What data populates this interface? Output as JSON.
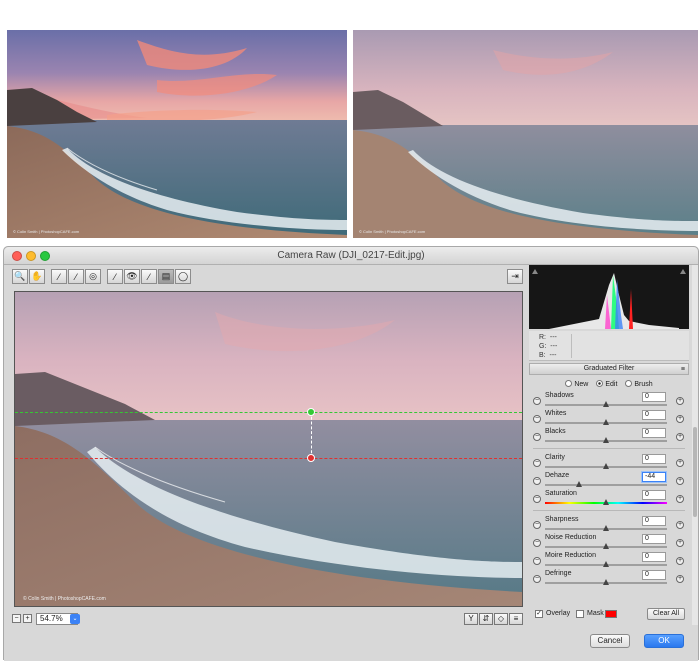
{
  "photos": {
    "before_credit": "© Colin Smith | PhotoshopCAFE.com",
    "after_credit": "© Colin Smith | PhotoshopCAFE.com"
  },
  "window": {
    "title": "Camera Raw (DJI_0217-Edit.jpg)",
    "traffic_colors": {
      "close": "#ff5f57",
      "minimize": "#febc2e",
      "zoom": "#28c840"
    }
  },
  "toolbar": {
    "tools": [
      {
        "name": "zoom-tool",
        "glyph": "🔍"
      },
      {
        "name": "hand-tool",
        "glyph": "✋"
      },
      {
        "name": "white-balance-tool",
        "glyph": "⁄"
      },
      {
        "name": "color-sampler-tool",
        "glyph": "⁄"
      },
      {
        "name": "targeted-adjustment-tool",
        "glyph": "◎"
      },
      {
        "name": "straighten-tool",
        "glyph": "⁄"
      },
      {
        "name": "red-eye-tool",
        "glyph": "👁"
      },
      {
        "name": "adjustment-brush-tool",
        "glyph": "⁄"
      },
      {
        "name": "graduated-filter-tool",
        "glyph": "▤"
      },
      {
        "name": "radial-filter-tool",
        "glyph": "◯"
      }
    ],
    "open-preferences-glyph": "⇥"
  },
  "preview": {
    "credit": "© Colin Smith | PhotoshopCAFE.com",
    "guide_colors": {
      "start": "#34c834",
      "end": "#e03030"
    }
  },
  "zoom": {
    "value": "54.7%"
  },
  "rgb_readout": {
    "r_label": "R:",
    "g_label": "G:",
    "b_label": "B:",
    "r": "---",
    "g": "---",
    "b": "---"
  },
  "panel": {
    "title": "Graduated Filter",
    "modes": {
      "new": "New",
      "edit": "Edit",
      "brush": "Brush",
      "selected": "Edit"
    },
    "sliders": [
      {
        "id": "shadows",
        "label": "Shadows",
        "value": "0"
      },
      {
        "id": "whites",
        "label": "Whites",
        "value": "0"
      },
      {
        "id": "blacks",
        "label": "Blacks",
        "value": "0"
      },
      {
        "id": "clarity",
        "label": "Clarity",
        "value": "0"
      },
      {
        "id": "dehaze",
        "label": "Dehaze",
        "value": "-44"
      },
      {
        "id": "saturation",
        "label": "Saturation",
        "value": "0"
      },
      {
        "id": "sharpness",
        "label": "Sharpness",
        "value": "0"
      },
      {
        "id": "noise-reduction",
        "label": "Noise Reduction",
        "value": "0"
      },
      {
        "id": "moire-reduction",
        "label": "Moire Reduction",
        "value": "0"
      },
      {
        "id": "defringe",
        "label": "Defringe",
        "value": "0"
      }
    ],
    "overlay_label": "Overlay",
    "overlay_checked": true,
    "mask_label": "Mask",
    "mask_checked": false,
    "mask_color": "#ff0000",
    "clear_all": "Clear All"
  },
  "dialog": {
    "cancel": "Cancel",
    "ok": "OK"
  }
}
